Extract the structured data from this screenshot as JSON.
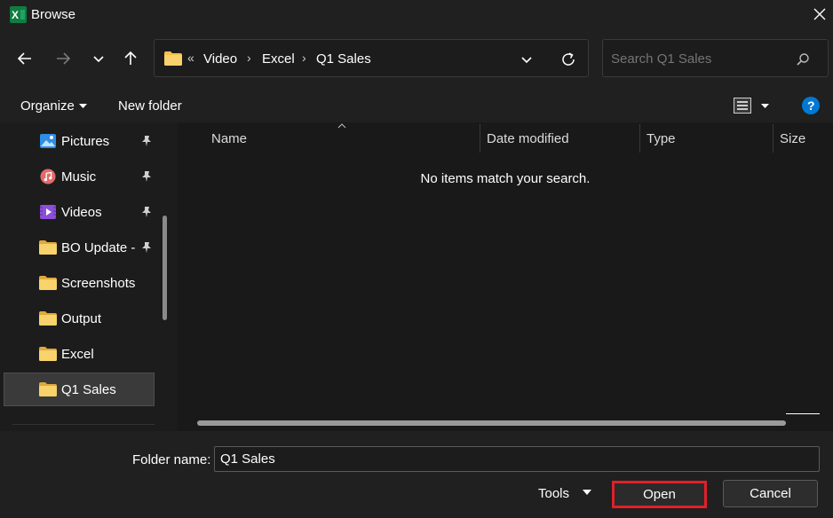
{
  "window": {
    "title": "Browse",
    "app_icon": "excel-icon",
    "close_icon": "close-icon"
  },
  "nav": {
    "back_icon": "arrow-left-icon",
    "forward_icon": "arrow-right-icon",
    "recent_icon": "chevron-down-icon",
    "up_icon": "arrow-up-icon"
  },
  "address": {
    "overflow": "«",
    "crumbs": [
      "Video",
      "Excel",
      "Q1 Sales"
    ],
    "separator": "›",
    "dropdown_icon": "chevron-down-icon",
    "refresh_icon": "refresh-icon"
  },
  "search": {
    "placeholder": "Search Q1 Sales",
    "icon": "search-icon"
  },
  "toolbar": {
    "organize": "Organize",
    "new_folder": "New folder",
    "view_icon": "view-list-icon",
    "help_icon": "help-icon"
  },
  "sidebar": {
    "items": [
      {
        "label": "Pictures",
        "icon": "pictures-icon",
        "pinned": true
      },
      {
        "label": "Music",
        "icon": "music-icon",
        "pinned": true
      },
      {
        "label": "Videos",
        "icon": "videos-icon",
        "pinned": true
      },
      {
        "label": "BO Update -",
        "icon": "folder-icon",
        "pinned": true
      },
      {
        "label": "Screenshots",
        "icon": "folder-icon",
        "pinned": false
      },
      {
        "label": "Output",
        "icon": "folder-icon",
        "pinned": false
      },
      {
        "label": "Excel",
        "icon": "folder-icon",
        "pinned": false
      },
      {
        "label": "Q1 Sales",
        "icon": "folder-icon",
        "pinned": false,
        "selected": true
      }
    ]
  },
  "list": {
    "columns": [
      "Name",
      "Date modified",
      "Type",
      "Size"
    ],
    "empty_message": "No items match your search."
  },
  "footer": {
    "folder_name_label": "Folder name:",
    "folder_name_value": "Q1 Sales",
    "tools": "Tools",
    "open": "Open",
    "cancel": "Cancel"
  },
  "colors": {
    "background": "#1c1c1c",
    "chrome": "#202020",
    "highlight": "#e0202a",
    "folder": "#f2c14e",
    "excel": "#107c41",
    "help": "#0078d4"
  }
}
